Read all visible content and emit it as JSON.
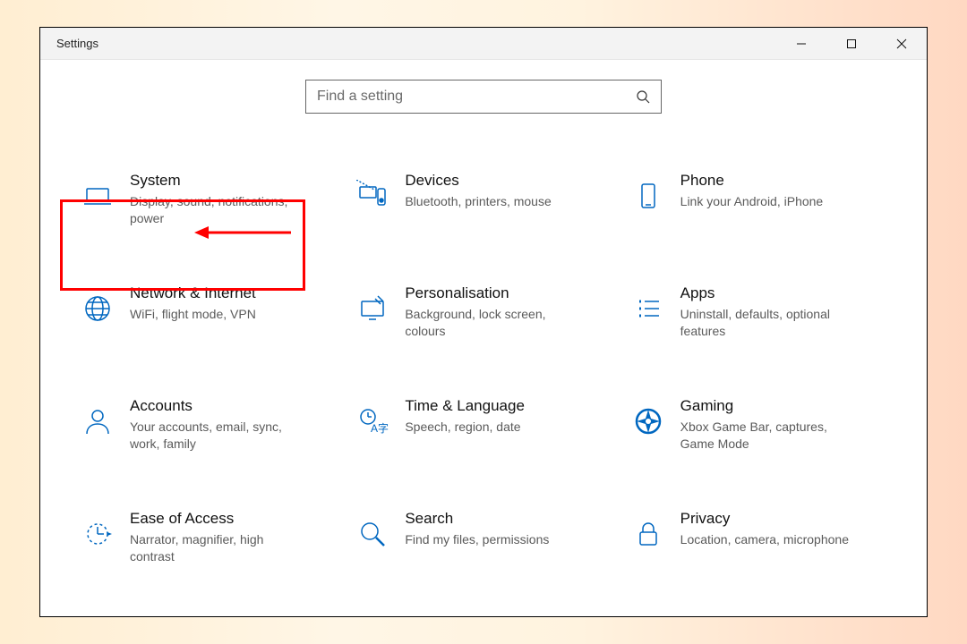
{
  "window": {
    "title": "Settings"
  },
  "search": {
    "placeholder": "Find a setting"
  },
  "tiles": [
    {
      "title": "System",
      "desc": "Display, sound, notifications, power",
      "icon": "laptop"
    },
    {
      "title": "Devices",
      "desc": "Bluetooth, printers, mouse",
      "icon": "devices"
    },
    {
      "title": "Phone",
      "desc": "Link your Android, iPhone",
      "icon": "phone"
    },
    {
      "title": "Network & Internet",
      "desc": "WiFi, flight mode, VPN",
      "icon": "globe"
    },
    {
      "title": "Personalisation",
      "desc": "Background, lock screen, colours",
      "icon": "personalize"
    },
    {
      "title": "Apps",
      "desc": "Uninstall, defaults, optional features",
      "icon": "apps"
    },
    {
      "title": "Accounts",
      "desc": "Your accounts, email, sync, work, family",
      "icon": "person"
    },
    {
      "title": "Time & Language",
      "desc": "Speech, region, date",
      "icon": "timelang"
    },
    {
      "title": "Gaming",
      "desc": "Xbox Game Bar, captures, Game Mode",
      "icon": "gaming"
    },
    {
      "title": "Ease of Access",
      "desc": "Narrator, magnifier, high contrast",
      "icon": "ease"
    },
    {
      "title": "Search",
      "desc": "Find my files, permissions",
      "icon": "search"
    },
    {
      "title": "Privacy",
      "desc": "Location, camera, microphone",
      "icon": "privacy"
    }
  ],
  "annotations": {
    "highlight_tile_index": 0
  }
}
